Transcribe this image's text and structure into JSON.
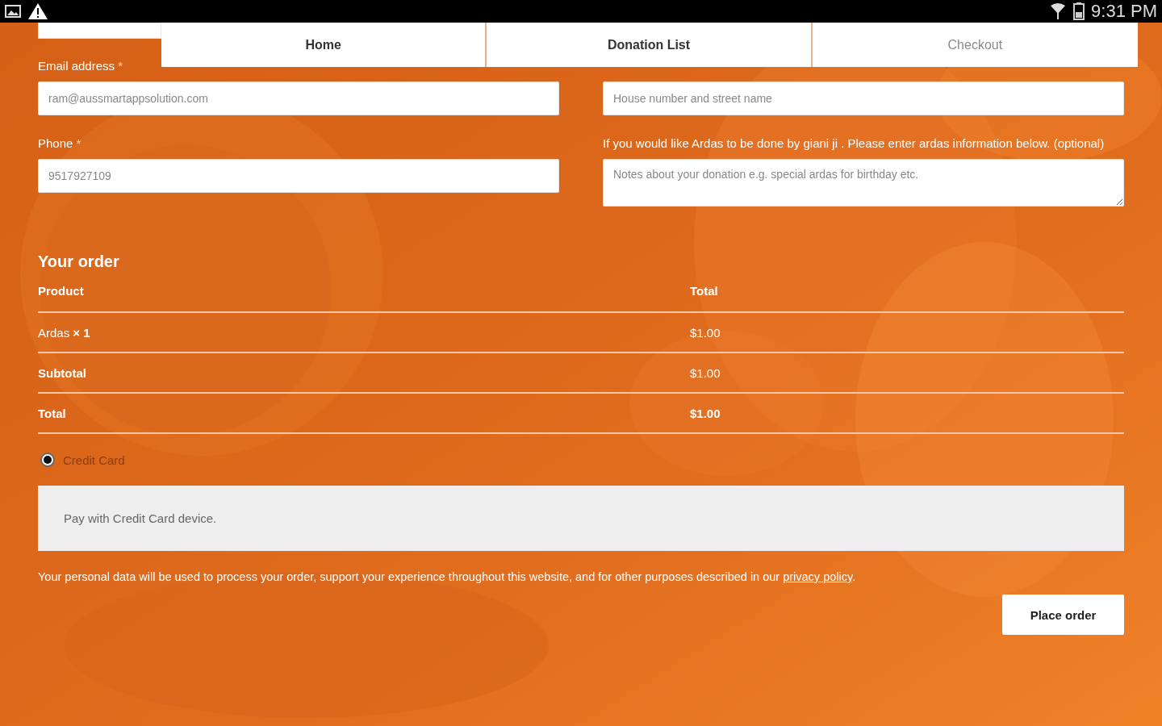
{
  "status_bar": {
    "time": "9:31 PM"
  },
  "tabs": [
    {
      "label": "Home",
      "selected": false
    },
    {
      "label": "Donation List",
      "selected": false
    },
    {
      "label": "Checkout",
      "selected": true
    }
  ],
  "billing": {
    "left": [
      {
        "label": "Email address",
        "required_mark": "*",
        "value": "ram@aussmartappsolution.com"
      },
      {
        "label": "Phone",
        "required_mark": "*",
        "value": "9517927109"
      }
    ],
    "street": {
      "placeholder": "House number and street name"
    },
    "notes": {
      "label": "If you would like Ardas to be done by giani ji . Please enter ardas information below. (optional)",
      "placeholder": "Notes about your donation e.g. special ardas for birthday etc."
    }
  },
  "order": {
    "title": "Your order",
    "columns": [
      "Product",
      "Total"
    ],
    "rows": [
      {
        "kind": "item",
        "product": "Ardas **× 1**",
        "total": "$1.00"
      },
      {
        "kind": "subtotal",
        "product": "Subtotal",
        "total": "$1.00"
      },
      {
        "kind": "total",
        "product": "Total",
        "total": "$1.00"
      }
    ]
  },
  "payment": {
    "method": "Credit Card",
    "selected": true,
    "description": "Pay with Credit Card device."
  },
  "privacy": {
    "text": "Your personal data will be used to process your order, support your experience throughout this website, and for other purposes described in our",
    "link": "privacy policy",
    "end": "."
  },
  "place_order": "Place order"
}
